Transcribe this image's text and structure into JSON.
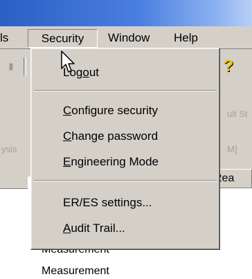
{
  "menubar": {
    "items": [
      {
        "label": "ls"
      },
      {
        "label": "Security"
      },
      {
        "label": "Window"
      },
      {
        "label": "Help"
      }
    ]
  },
  "toolbar": {
    "help_icon_glyph": "?"
  },
  "background": {
    "ghost_texts": [
      "ult St",
      "ysis",
      "M]"
    ],
    "column_header": "Rea",
    "rows": [
      "Measurement",
      "Measurement"
    ]
  },
  "security_menu": {
    "items": [
      {
        "label": "Logout",
        "accel_index": 3
      },
      {
        "label": "Configure security",
        "accel_index": 0
      },
      {
        "label": "Change password",
        "accel_index": 0
      },
      {
        "label": "Engineering Mode",
        "accel_index": 0
      },
      {
        "label": "ER/ES settings...",
        "accel_index": -1
      },
      {
        "label": "Audit Trail...",
        "accel_index": 0
      }
    ]
  },
  "colors": {
    "menu_face": "#d4d0c8",
    "title_start": "#2b5fc4",
    "title_end": "#b7cff5",
    "help_icon": "#f2c200"
  }
}
